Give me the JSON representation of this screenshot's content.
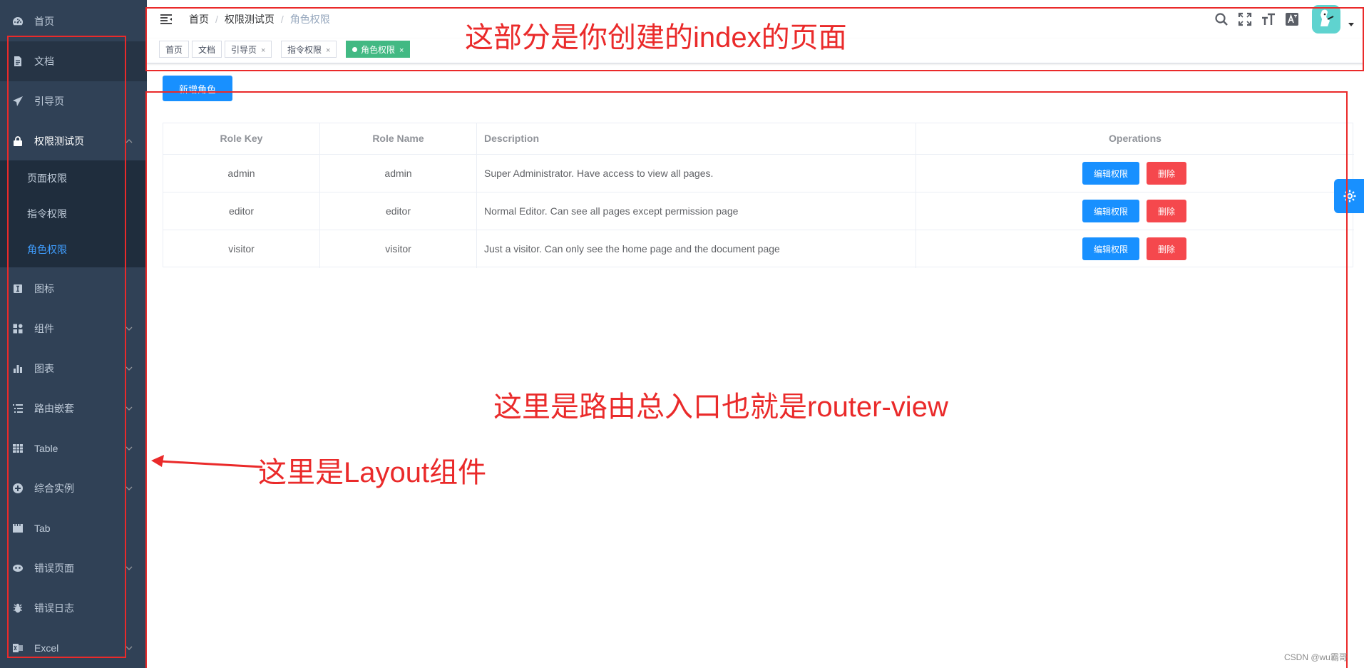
{
  "sidebar": {
    "items": [
      {
        "label": "首页",
        "icon": "dashboard-icon"
      },
      {
        "label": "文档",
        "icon": "document-icon"
      },
      {
        "label": "引导页",
        "icon": "guide-icon"
      },
      {
        "label": "权限测试页",
        "icon": "lock-icon",
        "expanded": true
      },
      {
        "label": "图标",
        "icon": "icon-icon"
      },
      {
        "label": "组件",
        "icon": "component-icon"
      },
      {
        "label": "图表",
        "icon": "chart-icon"
      },
      {
        "label": "路由嵌套",
        "icon": "nested-icon"
      },
      {
        "label": "Table",
        "icon": "table-icon"
      },
      {
        "label": "综合实例",
        "icon": "example-icon"
      },
      {
        "label": "Tab",
        "icon": "tab-icon"
      },
      {
        "label": "错误页面",
        "icon": "error-page-icon"
      },
      {
        "label": "错误日志",
        "icon": "bug-icon"
      },
      {
        "label": "Excel",
        "icon": "excel-icon"
      }
    ],
    "submenu": [
      {
        "label": "页面权限"
      },
      {
        "label": "指令权限"
      },
      {
        "label": "角色权限",
        "active": true
      }
    ]
  },
  "breadcrumb": [
    "首页",
    "权限测试页",
    "角色权限"
  ],
  "breadcrumb_separator": "/",
  "tags": [
    {
      "label": "首页",
      "closable": false
    },
    {
      "label": "文档",
      "closable": false
    },
    {
      "label": "引导页",
      "closable": true
    },
    {
      "label": "指令权限",
      "closable": true
    },
    {
      "label": "角色权限",
      "closable": true,
      "active": true
    }
  ],
  "tag_close_glyph": "×",
  "main": {
    "add_role_label": "新增角色",
    "table": {
      "headers": [
        "Role Key",
        "Role Name",
        "Description",
        "Operations"
      ],
      "rows": [
        {
          "key": "admin",
          "name": "admin",
          "description": "Super Administrator. Have access to view all pages."
        },
        {
          "key": "editor",
          "name": "editor",
          "description": "Normal Editor. Can see all pages except permission page"
        },
        {
          "key": "visitor",
          "name": "visitor",
          "description": "Just a visitor. Can only see the home page and the document page"
        }
      ],
      "edit_label": "编辑权限",
      "delete_label": "删除"
    }
  },
  "annotations": {
    "navbar_note": "这部分是你创建的index的页面",
    "main_note": "这里是路由总入口也就是router-view",
    "layout_note": "这里是Layout组件"
  },
  "watermark": "CSDN @wu霸哥",
  "colors": {
    "sidebar_bg": "#304156",
    "submenu_bg": "#1f2d3d",
    "active_text": "#409EFF",
    "primary": "#1890ff",
    "danger": "#f5484d",
    "tag_active": "#42b983",
    "annotation": "#ea2a2a"
  }
}
